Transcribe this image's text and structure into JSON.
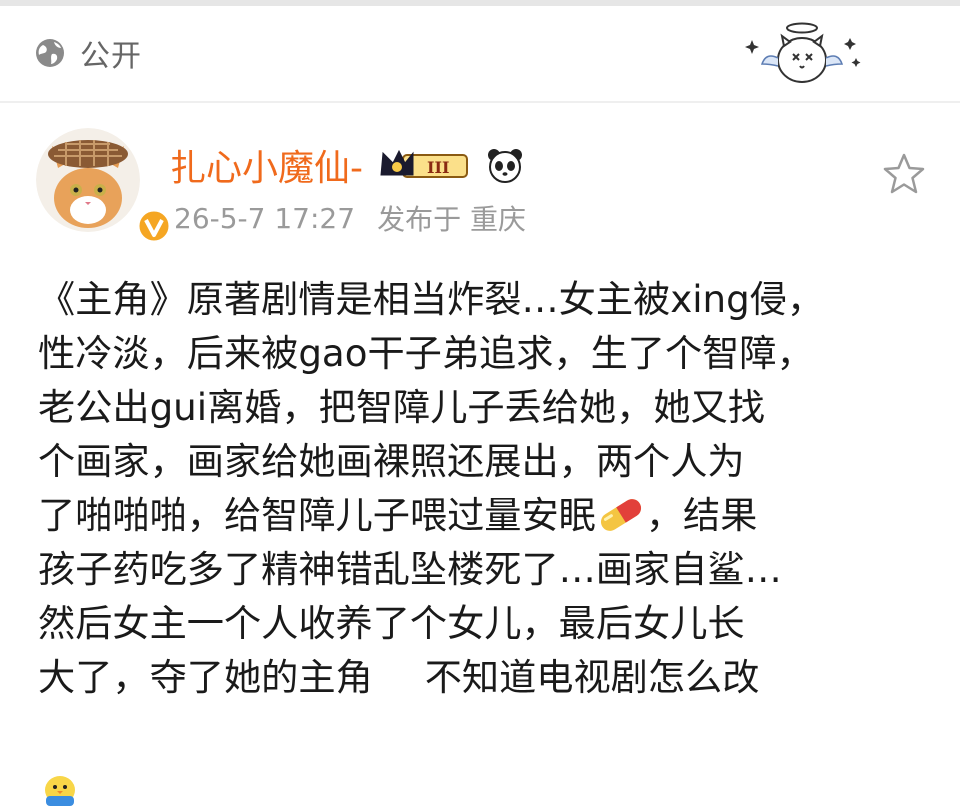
{
  "header": {
    "visibility_label": "公开",
    "globe_icon": "globe-icon",
    "sticker": "angel-cat-sticker"
  },
  "post": {
    "username": "扎心小魔仙-",
    "badges": [
      "crown-vip-III-badge",
      "panda-icon",
      "verified-badge"
    ],
    "timestamp": "26-5-7 17:27",
    "location": "发布于 重庆",
    "favorite_icon": "star-icon",
    "lines": [
      "《主角》原著剧情是相当炸裂…女主被xing侵，",
      "性冷淡，后来被gao干子弟追求，生了个智障，",
      "老公出gui离婚，把智障儿子丢给她，她又找",
      "个画家，画家给她画裸照还展出，两个人为",
      "了啪啪啪，给智障儿子喂过量安眠",
      "，结果",
      "孩子药吃多了精神错乱坠楼死了…画家自鲨…",
      "然后女主一个人收养了个女儿，最后女儿长",
      "大了，夺了她的主角",
      "不知道电视剧怎么改"
    ],
    "emoji": [
      "pill-emoji",
      "chick-emoji"
    ]
  },
  "colors": {
    "username": "#f06a1c",
    "meta": "#9a9a9a",
    "text": "#1a1a1a"
  }
}
